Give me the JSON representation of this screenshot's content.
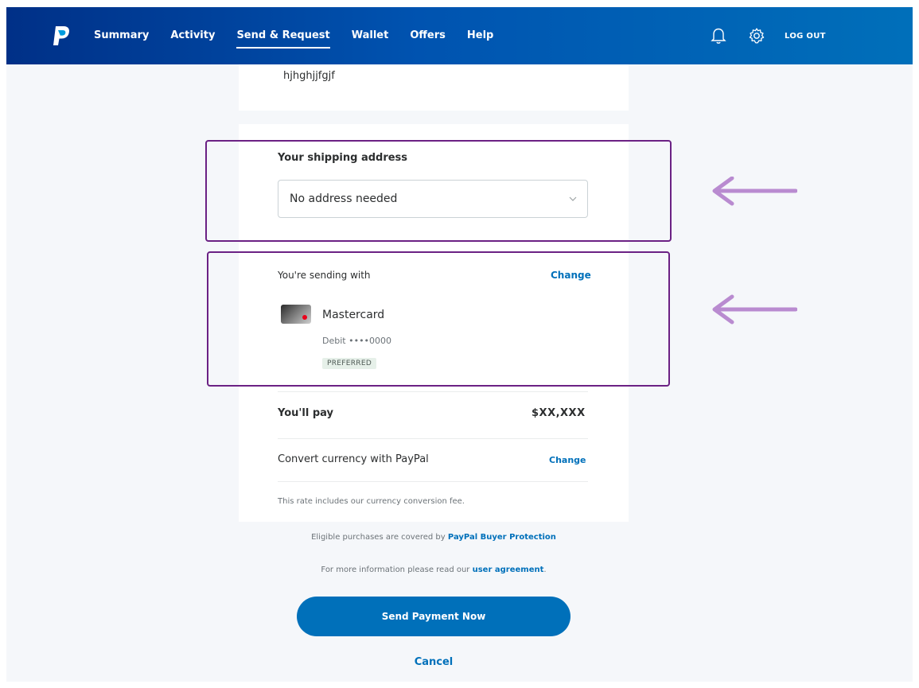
{
  "nav": {
    "items": [
      {
        "label": "Summary"
      },
      {
        "label": "Activity"
      },
      {
        "label": "Send & Request",
        "active": true
      },
      {
        "label": "Wallet"
      },
      {
        "label": "Offers"
      },
      {
        "label": "Help"
      }
    ],
    "logout_label": "LOG OUT",
    "icons": [
      "paypal-logo",
      "bell-icon",
      "gear-icon"
    ],
    "brand_color": "#0070ba"
  },
  "memo": "hjhghjjfgjf",
  "shipping": {
    "title": "Your shipping address",
    "selected": "No address needed"
  },
  "funding": {
    "title": "You're sending with",
    "change_label": "Change",
    "card_name": "Mastercard",
    "card_detail": "Debit ••••0000",
    "badge": "PREFERRED"
  },
  "payment": {
    "pay_label": "You'll pay",
    "amount": "$XX,XXX",
    "convert_label": "Convert currency with PayPal",
    "convert_change_label": "Change",
    "rate_note": "This rate includes our currency conversion fee."
  },
  "footer": {
    "protection_prefix": "Eligible purchases are covered by",
    "protection_link": "PayPal Buyer Protection",
    "agreement_prefix": "For more information please read our",
    "agreement_link": "user agreement",
    "agreement_suffix": "."
  },
  "actions": {
    "send_label": "Send Payment Now",
    "cancel_label": "Cancel"
  },
  "annotation": {
    "highlight_color": "#6b2184",
    "arrow_color": "#b98bd0"
  }
}
